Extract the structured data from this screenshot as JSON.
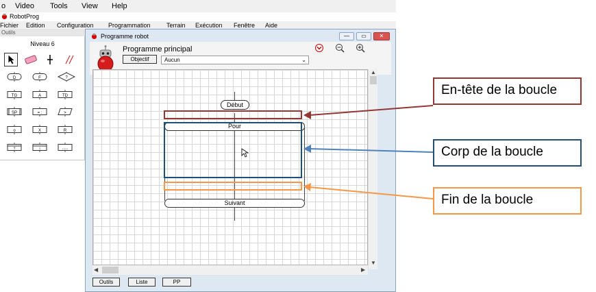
{
  "top_menu": [
    "o",
    "Video",
    "Tools",
    "View",
    "Help"
  ],
  "app": {
    "title": "RobotProg",
    "menu": [
      "Fichier",
      "Edition",
      "Configuration",
      "Programmation",
      "Terrain",
      "Exécution",
      "Fenêtre",
      "Aide"
    ]
  },
  "tools": {
    "window_title": "Outils",
    "level": "Niveau 6",
    "shape_labels": {
      "d": "D",
      "f": "F",
      "q": "?",
      "tg": "TG",
      "a": "A",
      "td": "TD",
      "sp": "SP",
      "eq": "= :",
      "gt": ">",
      "o": "o",
      "x": "X",
      "r": "R",
      "q2": "?",
      "i": "i",
      "dots": "....."
    }
  },
  "program_window": {
    "title": "Programme robot",
    "main_label": "Programme principal",
    "objective_button": "Objectif",
    "objective_value": "Aucun",
    "controls": [
      "—",
      "▭",
      "✕"
    ],
    "bottom_buttons": [
      "Outils",
      "Liste",
      "PP"
    ]
  },
  "flowchart": {
    "start": "Début",
    "loop_header": "Pour",
    "loop_end": "Suivant"
  },
  "annotations": {
    "header": {
      "label": "En-tête de la boucle",
      "color": "#943634"
    },
    "body": {
      "label": "Corp de la boucle",
      "color": "#1f4e79"
    },
    "end": {
      "label": "Fin de la boucle",
      "color": "#f79646"
    },
    "body_arrow_color": "#4f81bd"
  }
}
